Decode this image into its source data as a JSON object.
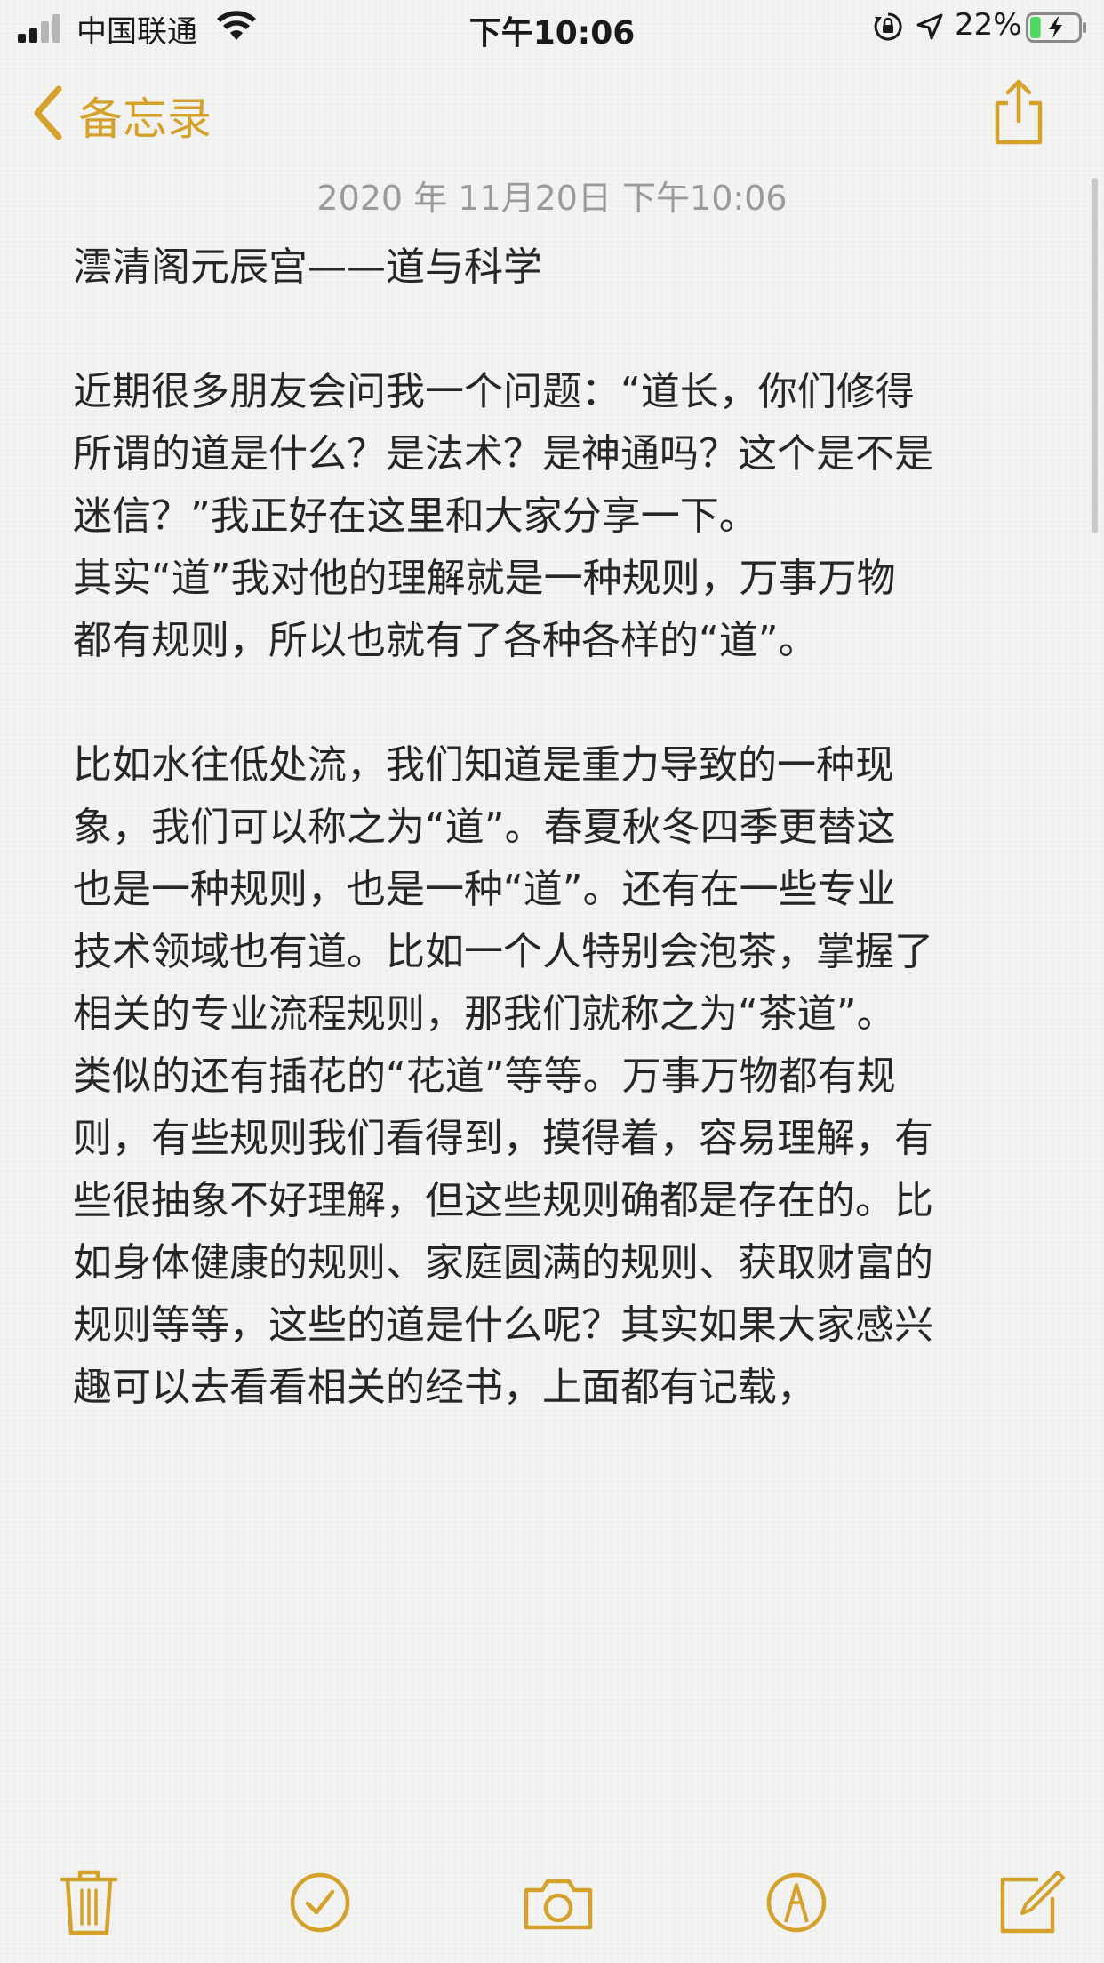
{
  "status_bar": {
    "carrier": "中国联通",
    "time": "下午10:06",
    "battery_percent": "22%",
    "battery_level": 0.22,
    "icons": [
      "signal-icon",
      "wifi-icon",
      "orientation-lock-icon",
      "location-icon",
      "battery-charging-icon"
    ]
  },
  "nav": {
    "back_label": "备忘录",
    "accent_color": "#d4a12a",
    "icons": [
      "chevron-left-icon",
      "share-icon"
    ]
  },
  "note": {
    "date": "2020 年 11月20日 下午10:06",
    "title": "澐清阁元辰宫——道与科学",
    "paragraph1_lines": [
      "近期很多朋友会问我一个问题：“道长，你们修得",
      "所谓的道是什么？是法术？是神通吗？这个是不是",
      "迷信？”我正好在这里和大家分享一下。",
      "其实“道”我对他的理解就是一种规则，万事万物",
      "都有规则，所以也就有了各种各样的“道”。"
    ],
    "paragraph2_lines": [
      "比如水往低处流，我们知道是重力导致的一种现",
      "象，我们可以称之为“道”。春夏秋冬四季更替这",
      "也是一种规则，也是一种“道”。还有在一些专业",
      "技术领域也有道。比如一个人特别会泡茶，掌握了",
      "相关的专业流程规则，那我们就称之为“茶道”。",
      "类似的还有插花的“花道”等等。万事万物都有规",
      "则，有些规则我们看得到，摸得着，容易理解，有",
      "些很抽象不好理解，但这些规则确都是存在的。比",
      "如身体健康的规则、家庭圆满的规则、获取财富的",
      "规则等等，这些的道是什么呢？其实如果大家感兴",
      "趣可以去看看相关的经书，上面都有记载，"
    ]
  },
  "toolbar": {
    "icons": [
      "trash-icon",
      "checklist-icon",
      "camera-icon",
      "markup-icon",
      "compose-icon"
    ]
  }
}
